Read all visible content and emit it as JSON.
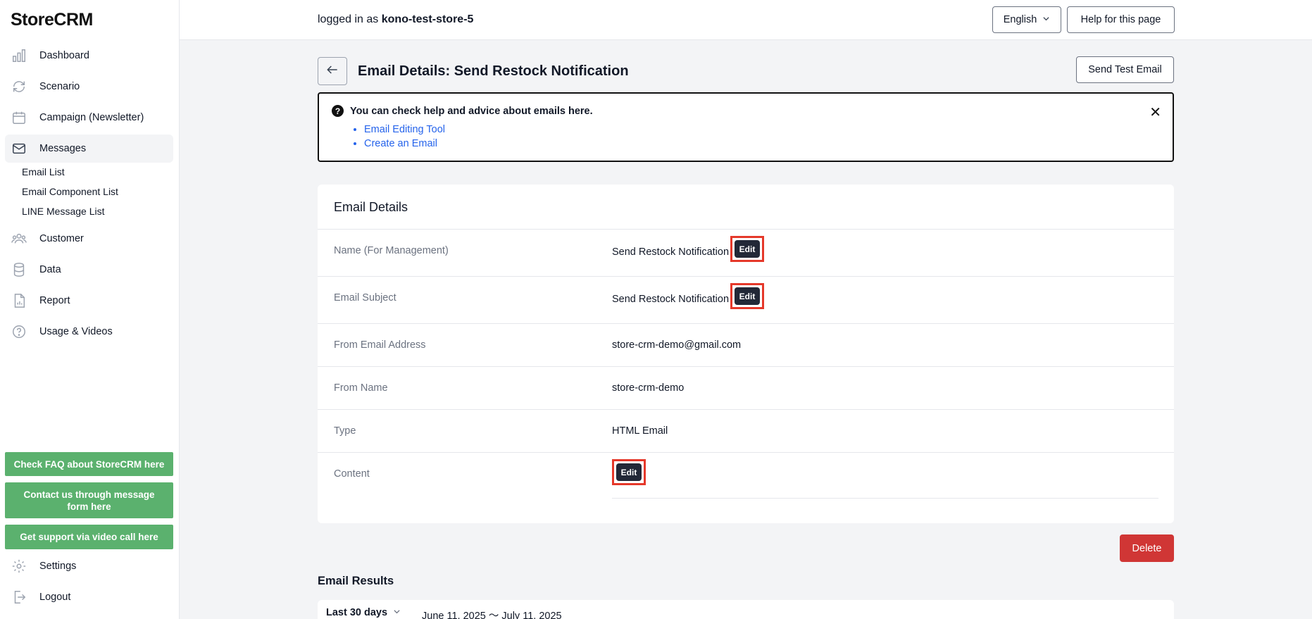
{
  "app": {
    "name": "StoreCRM"
  },
  "sidebar": {
    "items": [
      {
        "label": "Dashboard",
        "icon": "bar-chart-icon"
      },
      {
        "label": "Scenario",
        "icon": "refresh-icon"
      },
      {
        "label": "Campaign (Newsletter)",
        "icon": "calendar-icon"
      },
      {
        "label": "Messages",
        "icon": "mail-icon"
      },
      {
        "label": "Customer",
        "icon": "users-icon"
      },
      {
        "label": "Data",
        "icon": "database-icon"
      },
      {
        "label": "Report",
        "icon": "document-chart-icon"
      },
      {
        "label": "Usage & Videos",
        "icon": "question-icon"
      }
    ],
    "sub_items": [
      "Email List",
      "Email Component List",
      "LINE Message List"
    ],
    "support_buttons": [
      "Check FAQ about StoreCRM here",
      "Contact us through message form here",
      "Get support via video call here"
    ],
    "settings_label": "Settings",
    "logout_label": "Logout"
  },
  "header": {
    "logged_prefix": "logged in as",
    "store_name": "kono-test-store-5",
    "language": "English",
    "help_label": "Help for this page"
  },
  "page": {
    "title": "Email Details: Send Restock Notification",
    "send_test_label": "Send Test Email"
  },
  "help_box": {
    "title": "You can check help and advice about emails here.",
    "links": [
      "Email Editing Tool",
      "Create an Email"
    ],
    "close": "✕"
  },
  "details": {
    "title": "Email Details",
    "edit_label": "Edit",
    "rows": [
      {
        "key": "Name (For Management)",
        "value": "Send Restock Notification"
      },
      {
        "key": "Email Subject",
        "value": "Send Restock Notification"
      },
      {
        "key": "From Email Address",
        "value": "store-crm-demo@gmail.com"
      },
      {
        "key": "From Name",
        "value": "store-crm-demo"
      },
      {
        "key": "Type",
        "value": "HTML Email"
      },
      {
        "key": "Content",
        "value": ""
      }
    ],
    "delete_label": "Delete"
  },
  "results": {
    "title": "Email Results",
    "range": "Last 30 days",
    "dates": "June 11, 2025 〜 July 11, 2025"
  },
  "colors": {
    "support_green": "#5bb16e",
    "delete_red": "#d03635",
    "highlight_red": "#e5382a",
    "edit_dark": "#222837"
  }
}
